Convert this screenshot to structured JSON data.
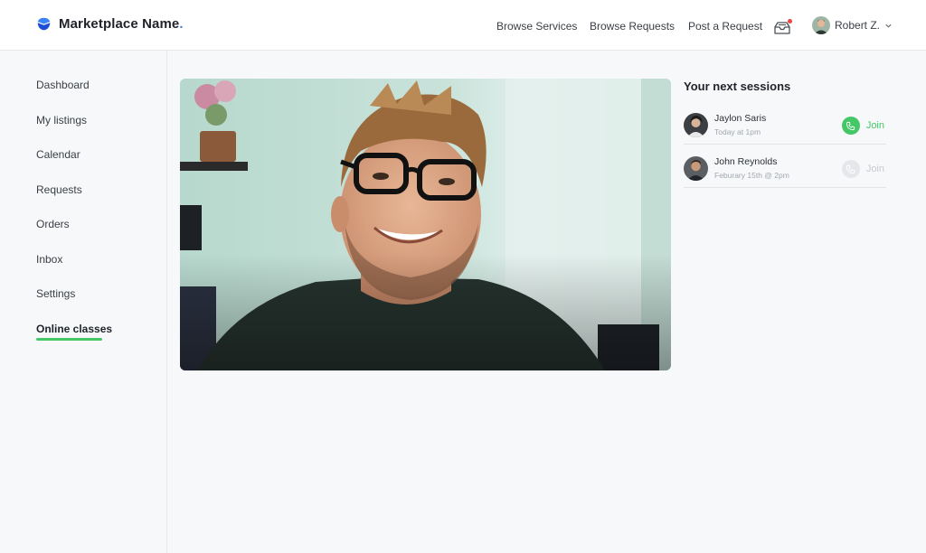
{
  "brand": {
    "name": "Marketplace Name",
    "dot": ".",
    "accent": "#3b82f6"
  },
  "nav": {
    "browse_services": "Browse Services",
    "browse_requests": "Browse Requests",
    "post_request": "Post a Request",
    "inbox_icon": "inbox-icon",
    "notification_color": "#ef4444"
  },
  "user": {
    "name": "Robert Z."
  },
  "sidebar": {
    "items": [
      {
        "label": "Dashboard"
      },
      {
        "label": "My listings"
      },
      {
        "label": "Calendar"
      },
      {
        "label": "Requests"
      },
      {
        "label": "Orders"
      },
      {
        "label": "Inbox"
      },
      {
        "label": "Settings"
      },
      {
        "label": "Online classes",
        "active": true
      }
    ],
    "active_color": "#44c767"
  },
  "sessions": {
    "title": "Your next sessions",
    "items": [
      {
        "name": "Jaylon Saris",
        "time": "Today at 1pm",
        "join_label": "Join",
        "join_enabled": true
      },
      {
        "name": "John Reynolds",
        "time": "Feburary 15th @ 2pm",
        "join_label": "Join",
        "join_enabled": false
      }
    ]
  },
  "colors": {
    "join_active": "#44c767",
    "join_disabled": "#e5e7ea"
  }
}
